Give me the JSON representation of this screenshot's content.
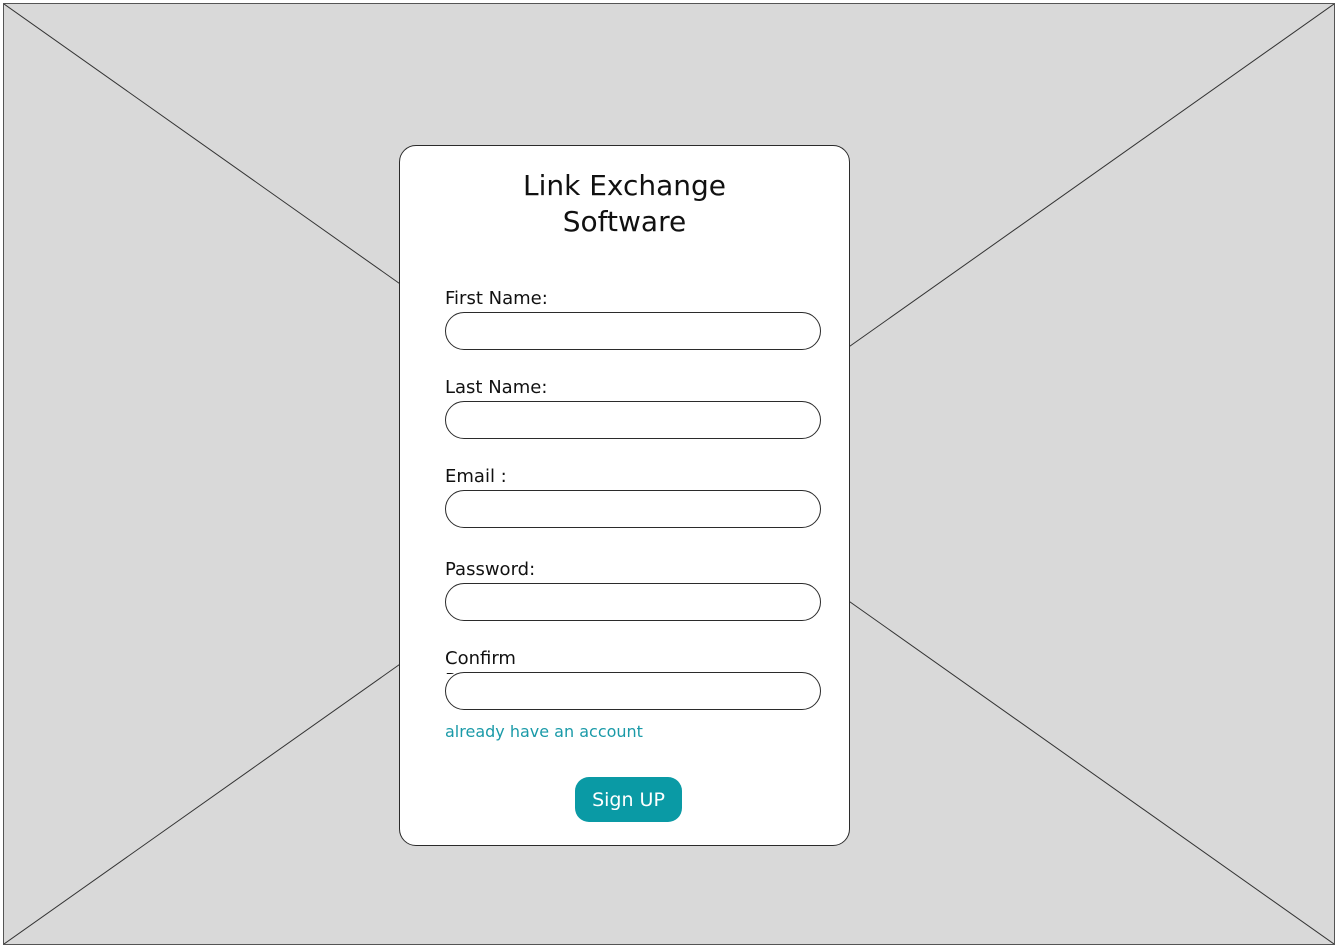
{
  "background": {
    "type": "image-placeholder",
    "color": "#d9d9d9"
  },
  "card": {
    "title_line1": "Link Exchange",
    "title_line2": "Software"
  },
  "form": {
    "first_name_label": "First Name:",
    "first_name_value": "",
    "last_name_label": "Last Name:",
    "last_name_value": "",
    "email_label": "Email :",
    "email_value": "",
    "password_label": "Password:",
    "password_value": "",
    "confirm_label": "Confirm Password:",
    "confirm_value": ""
  },
  "login_link": "already have an account",
  "signup_button": "Sign UP",
  "colors": {
    "accent": "#0a9aa5",
    "link": "#1a9aa8",
    "card_bg": "#ffffff",
    "page_bg": "#d9d9d9"
  }
}
